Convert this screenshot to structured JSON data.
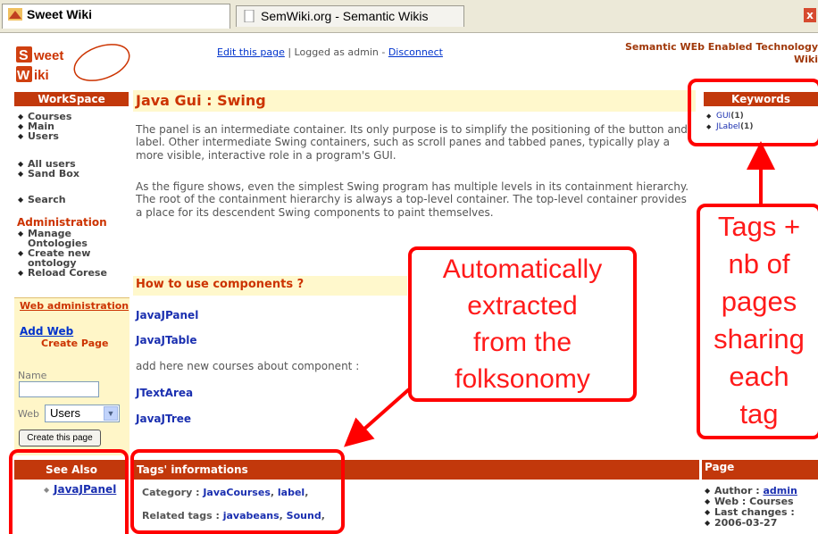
{
  "browser": {
    "tabs": [
      {
        "label": "Sweet Wiki",
        "active": true
      },
      {
        "label": "SemWiki.org - Semantic Wikis",
        "active": false
      }
    ],
    "close_label": "x"
  },
  "header": {
    "logo_top": "weet",
    "logo_bottom": "iki",
    "edit_link": "Edit this page",
    "separator": " | ",
    "logged_as": "Logged as admin - ",
    "disconnect_link": "Disconnect",
    "brand_line1": "Semantic WEb Enabled Technology",
    "brand_line2": "Wiki"
  },
  "sidebar": {
    "workspace_title": "WorkSpace",
    "group1": [
      "Courses",
      "Main",
      "Users"
    ],
    "group2": [
      "All users",
      "Sand Box"
    ],
    "search": "Search",
    "admin_title": "Administration",
    "admin_items": [
      "Manage Ontologies",
      "Create new ontology",
      "Reload Corese"
    ],
    "web_admin_link": "Web administration",
    "add_web": "Add Web",
    "create_page_label": "Create Page",
    "name_label": "Name",
    "name_value": "",
    "web_label": "Web",
    "web_selected": "Users",
    "create_button": "Create this page"
  },
  "main": {
    "title": "Java Gui : Swing",
    "para1": "The panel is an intermediate container. Its only purpose is to simplify the positioning of the button and label. Other intermediate Swing containers, such as scroll panes and tabbed panes, typically play a more visible, interactive role in a program's GUI.",
    "para2": "As the figure shows, even the simplest Swing program has multiple levels in its containment hierarchy. The root of the containment hierarchy is always a top-level container. The top-level container provides a place for its descendent Swing components to paint themselves.",
    "subtitle": "How to use components ?",
    "links": [
      "JavaJPanel",
      "JavaJTable"
    ],
    "add_here": "add here new courses about component :",
    "links2": [
      "JTextArea",
      "JavaJTree"
    ]
  },
  "keywords": {
    "title": "Keywords",
    "items": [
      {
        "tag": "GUI",
        "count": "(1)"
      },
      {
        "tag": "JLabel",
        "count": "(1)"
      }
    ]
  },
  "see_also": {
    "title": "See Also",
    "items": [
      "JavaJPanel"
    ]
  },
  "tags_info": {
    "title": "Tags' informations",
    "category_label": "Category : ",
    "categories": [
      "JavaCourses",
      "label"
    ],
    "related_label": "Related tags : ",
    "related": [
      "javabeans",
      "Sound"
    ]
  },
  "page_info": {
    "title": "Page",
    "author_label": "Author : ",
    "author": "admin",
    "web_label": "Web : Courses",
    "last_changes_label": "Last changes :",
    "last_changes_date": "2006-03-27"
  },
  "annotations": {
    "center": [
      "Automatically",
      "extracted",
      "from the",
      "folksonomy"
    ],
    "right": [
      "Tags +",
      "nb of",
      "pages",
      "sharing",
      "each",
      "tag"
    ]
  },
  "colors": {
    "header_bar": "#c2380b",
    "title_text": "#cc3300",
    "link": "#1a2fb0",
    "annotation": "#ff0000",
    "title_bg": "#fff8cc"
  }
}
